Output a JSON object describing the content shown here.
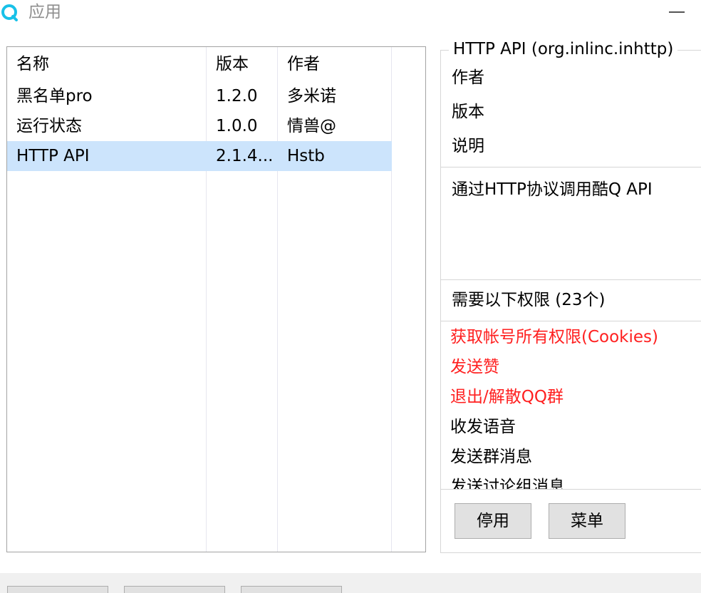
{
  "window": {
    "title": "应用",
    "accent_color": "#18c1e8",
    "icon": "app-logo-icon",
    "minimize_icon": "minimize-icon"
  },
  "app_list": {
    "columns": [
      "名称",
      "版本",
      "作者"
    ],
    "rows": [
      {
        "name": "黑名单pro",
        "version": "1.2.0",
        "author": "多米诺",
        "selected": false
      },
      {
        "name": "运行状态",
        "version": "1.0.0",
        "author": "情兽@",
        "selected": false
      },
      {
        "name": "HTTP API",
        "version": "2.1.4...",
        "author": "Hstb",
        "selected": true
      }
    ],
    "selection_color": "#cce4fc"
  },
  "detail": {
    "group_title": "HTTP API (org.inlinc.inhttp)",
    "author_label": "作者",
    "version_label": "版本",
    "description_label": "说明",
    "description": "通过HTTP协议调用酷Q API",
    "permissions_title": "需要以下权限 (23个)",
    "permissions": [
      {
        "text": "获取帐号所有权限(Cookies)",
        "dangerous": true
      },
      {
        "text": "发送赞",
        "dangerous": true
      },
      {
        "text": "退出/解散QQ群",
        "dangerous": true
      },
      {
        "text": "收发语音",
        "dangerous": false
      },
      {
        "text": "发送群消息",
        "dangerous": false
      },
      {
        "text": "发送讨论组消息",
        "dangerous": false
      }
    ],
    "danger_color": "#ff2020"
  },
  "buttons": {
    "disable_label": "停用",
    "menu_label": "菜单"
  }
}
